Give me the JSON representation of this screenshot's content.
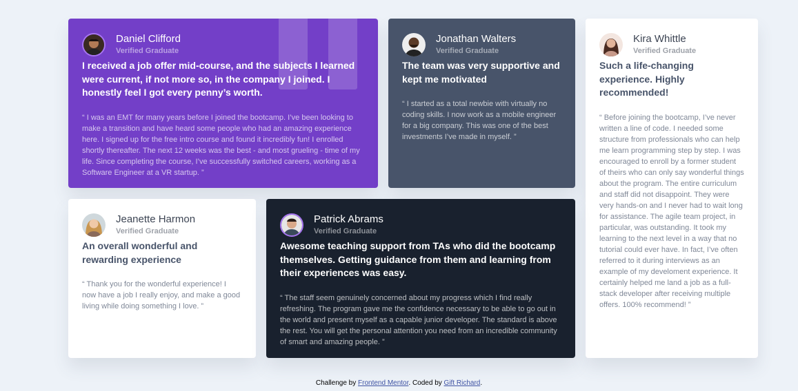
{
  "testimonials": [
    {
      "name": "Daniel Clifford",
      "role": "Verified Graduate",
      "headline": "I received a job offer mid-course, and the subjects I learned were current, if not more so, in the company I joined. I honestly feel I got every penny’s worth.",
      "body": "“ I was an EMT for many years before I joined the bootcamp. I’ve been looking to make a transition and have heard some people who had an amazing experience here. I signed up for the free intro course and found it incredibly fun! I enrolled shortly thereafter. The next 12 weeks was the best - and most grueling - time of my life. Since completing the course, I’ve successfully switched careers, working as a Software Engineer at a VR startup. ”"
    },
    {
      "name": "Jonathan Walters",
      "role": "Verified Graduate",
      "headline": "The team was very supportive and kept me motivated",
      "body": "“ I started as a total newbie with virtually no coding skills. I now work as a mobile engineer for a big company. This was one of the best investments I’ve made in myself. ”"
    },
    {
      "name": "Kira Whittle",
      "role": "Verified Graduate",
      "headline": "Such a life-changing experience. Highly recommended!",
      "body": "“ Before joining the bootcamp, I’ve never written a line of code. I needed some structure from professionals who can help me learn programming step by step. I was encouraged to enroll by a former student of theirs who can only say wonderful things about the program. The entire curriculum and staff did not disappoint. They were very hands-on and I never had to wait long for assistance. The agile team project, in particular, was outstanding. It took my learning to the next level in a way that no tutorial could ever have. In fact, I’ve often referred to it during interviews as an example of my develoment experience. It certainly helped me land a job as a full-stack developer after receiving multiple offers. 100% recommend! ”"
    },
    {
      "name": "Jeanette Harmon",
      "role": "Verified Graduate",
      "headline": "An overall wonderful and rewarding experience",
      "body": "“ Thank you for the wonderful experience! I now have a job I really enjoy, and make a good living while doing something I love. ”"
    },
    {
      "name": "Patrick Abrams",
      "role": "Verified Graduate",
      "headline": "Awesome teaching support from TAs who did the bootcamp themselves. Getting guidance from them and learning from their experiences was easy.",
      "body": "“ The staff seem genuinely concerned about my progress which I find really refreshing. The program gave me the confidence necessary to be able to go out in the world and present myself as a capable junior developer. The standard is above the rest. You will get the personal attention you need from an incredible community of smart and amazing people. ”"
    }
  ],
  "footer": {
    "prefix": "Challenge by ",
    "link1": "Frontend Mentor",
    "middle": ". Coded by ",
    "link2": "Gift Richard",
    "suffix": "."
  },
  "colors": {
    "moderate_violet": "#733fc8",
    "grayish_blue": "#48546a",
    "blackish_blue": "#19212e",
    "white": "#ffffff",
    "background": "#edf2f8"
  }
}
